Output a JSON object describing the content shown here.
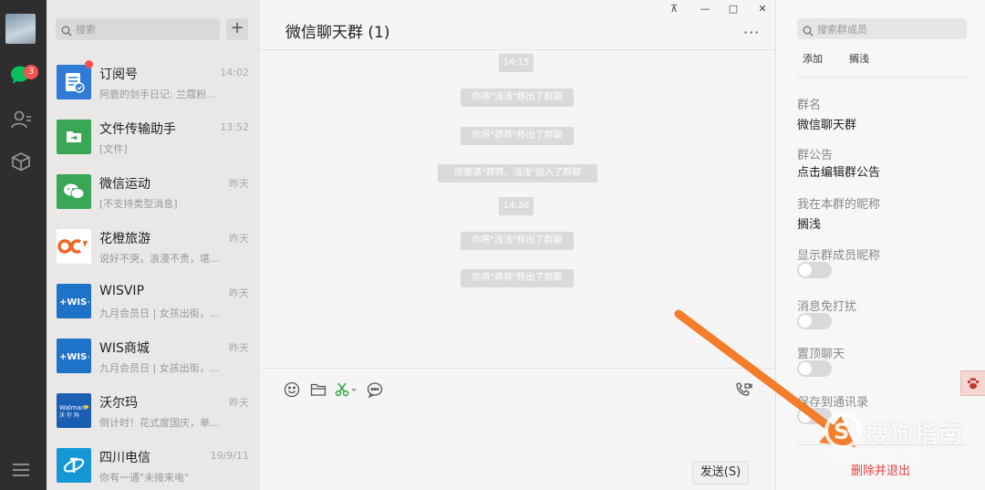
{
  "nav": {
    "unread_badge": "3",
    "icons": [
      "chat-icon",
      "contacts-icon",
      "favorites-icon",
      "menu-icon"
    ]
  },
  "chat_list": {
    "search_placeholder": "搜索",
    "add_label": "+",
    "items": [
      {
        "name": "订阅号",
        "time": "14:02",
        "message": "阿鹿的剑手日记: 兰蔻粉...",
        "avatar_color": "#2f7bd6",
        "unread_dot": true
      },
      {
        "name": "文件传输助手",
        "time": "13:52",
        "message": "[文件]",
        "avatar_color": "#3aa757"
      },
      {
        "name": "微信运动",
        "time": "昨天",
        "message": "[不支持类型消息]",
        "avatar_color": "#3aa757"
      },
      {
        "name": "花橙旅游",
        "time": "昨天",
        "message": "说好不哭，浪漫不贵，堪...",
        "avatar_color": "#ffffff"
      },
      {
        "name": "WISVIP",
        "time": "昨天",
        "message": "九月会员日 | 女孩出街，...",
        "avatar_color": "#1e73c9"
      },
      {
        "name": "WIS商城",
        "time": "昨天",
        "message": "九月会员日 | 女孩出街，...",
        "avatar_color": "#1e73c9"
      },
      {
        "name": "沃尔玛",
        "time": "昨天",
        "message": "倒计时！花式度国庆，单...",
        "avatar_color": "#1a5fb4"
      },
      {
        "name": "四川电信",
        "time": "19/9/11",
        "message": "你有一通\"未接来电\"",
        "avatar_color": "#1597d6"
      }
    ]
  },
  "chat": {
    "title": "微信聊天群 (1)",
    "more_label": "···",
    "messages": [
      {
        "text": "14:15"
      },
      {
        "text": "你将\"浅浅\"移出了群聊"
      },
      {
        "text": "你将\"莽莽\"移出了群聊"
      },
      {
        "text": "你邀请\"莽莽、浅浅\"加入了群聊"
      },
      {
        "text": "14:36"
      },
      {
        "text": "你将\"浅浅\"移出了群聊"
      },
      {
        "text": "你将\"莽莽\"移出了群聊"
      }
    ],
    "send_label": "发送(S)"
  },
  "window_controls": {
    "pin": "⊼",
    "minimize": "—",
    "maximize": "□",
    "close": "✕"
  },
  "panel": {
    "search_placeholder": "搜索群成员",
    "member_add": "添加",
    "member_name": "搁浅",
    "group_name_label": "群名",
    "group_name_value": "微信聊天群",
    "notice_label": "群公告",
    "notice_value": "点击编辑群公告",
    "nickname_label": "我在本群的昵称",
    "nickname_value": "搁浅",
    "show_nick_label": "显示群成员昵称",
    "mute_label": "消息免打扰",
    "pin_label": "置顶聊天",
    "save_label": "保存到通讯录",
    "exit_label": "删除并退出"
  },
  "watermark": {
    "text": "搜狗指南",
    "sub": "zhinan.sogou.com"
  },
  "colors": {
    "accent_green": "#07c160",
    "arrow_orange": "#f47c2a",
    "danger_red": "#e64340"
  }
}
